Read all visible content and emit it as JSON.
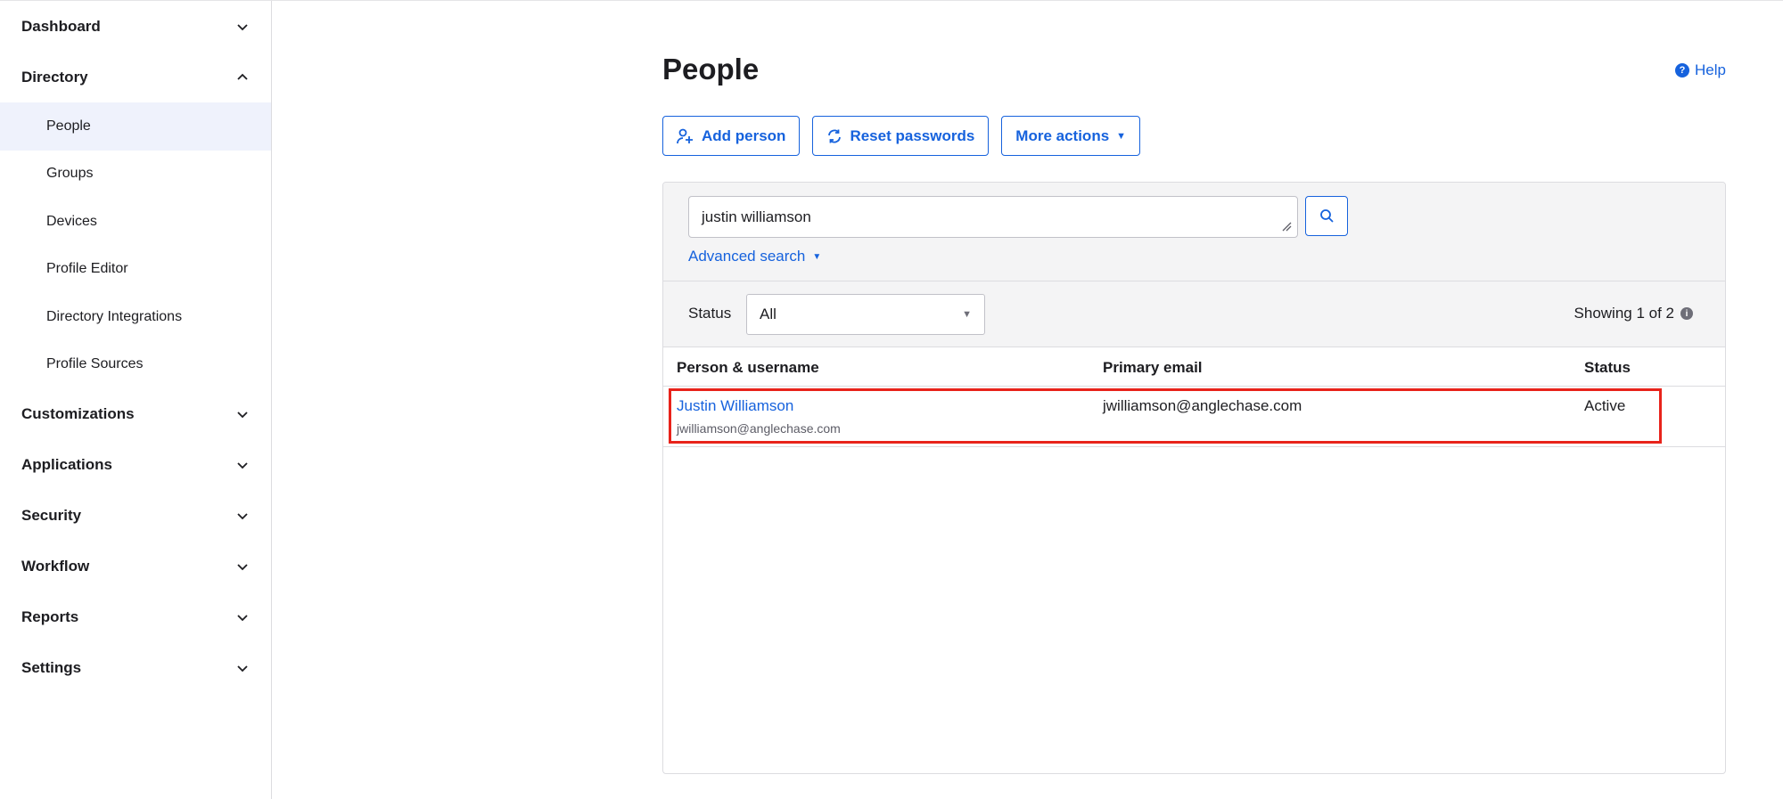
{
  "sidebar": {
    "sections": [
      {
        "label": "Dashboard",
        "expanded": false
      },
      {
        "label": "Directory",
        "expanded": true,
        "items": [
          "People",
          "Groups",
          "Devices",
          "Profile Editor",
          "Directory Integrations",
          "Profile Sources"
        ],
        "active_item": "People"
      },
      {
        "label": "Customizations",
        "expanded": false
      },
      {
        "label": "Applications",
        "expanded": false
      },
      {
        "label": "Security",
        "expanded": false
      },
      {
        "label": "Workflow",
        "expanded": false
      },
      {
        "label": "Reports",
        "expanded": false
      },
      {
        "label": "Settings",
        "expanded": false
      }
    ]
  },
  "header": {
    "title": "People",
    "help_label": "Help",
    "help_icon_glyph": "?"
  },
  "toolbar": {
    "add_person": "Add person",
    "reset_passwords": "Reset passwords",
    "more_actions": "More actions",
    "more_actions_caret": "▼"
  },
  "search": {
    "value": "justin williamson",
    "advanced_label": "Advanced search",
    "advanced_caret": "▼"
  },
  "filter": {
    "status_label": "Status",
    "status_value": "All",
    "select_caret": "▼",
    "showing_text": "Showing 1 of 2",
    "info_icon_glyph": "i"
  },
  "table": {
    "columns": [
      "Person & username",
      "Primary email",
      "Status"
    ],
    "rows": [
      {
        "name": "Justin Williamson",
        "username": "jwilliamson@anglechase.com",
        "email": "jwilliamson@anglechase.com",
        "status": "Active"
      }
    ]
  },
  "colors": {
    "accent": "#1662dd",
    "highlight": "#e8231b",
    "active_nav_bg": "#eff2fc",
    "panel_bg": "#f4f4f5"
  }
}
